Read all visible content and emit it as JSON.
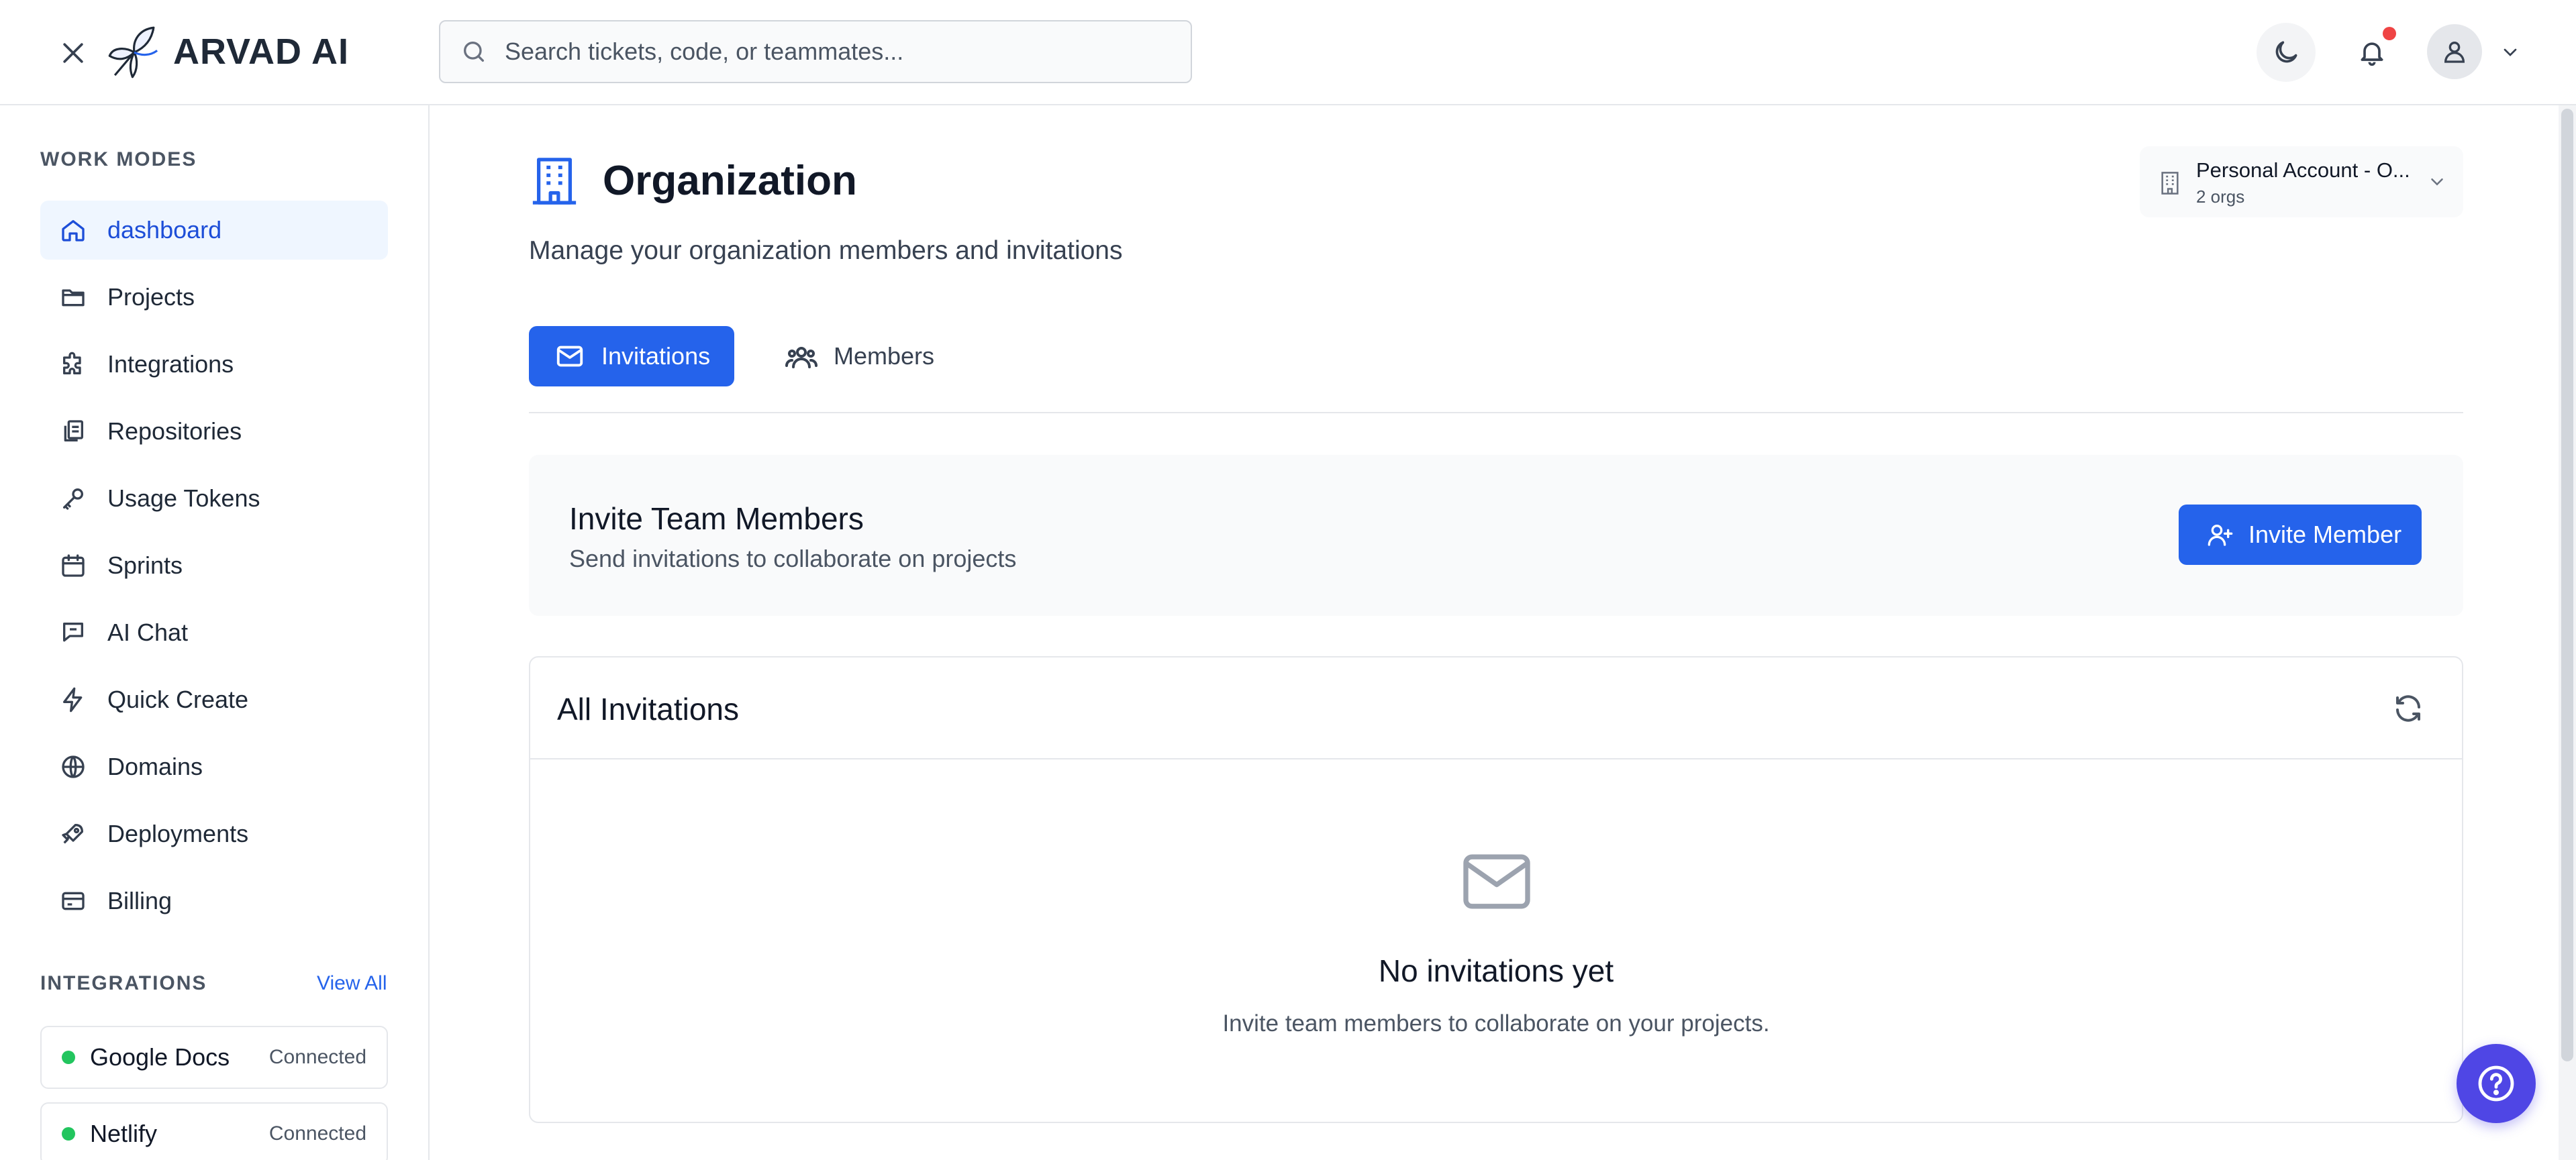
{
  "header": {
    "brand": "ARVAD AI",
    "search_placeholder": "Search tickets, code, or teammates...",
    "icons": [
      "close-icon",
      "butterfly-logo",
      "search-icon",
      "moon-icon",
      "bell-icon",
      "user-icon",
      "chevron-down-icon"
    ],
    "notification_dot_color": "#ef4444"
  },
  "sidebar": {
    "work_modes_label": "WORK MODES",
    "items": [
      {
        "label": "dashboard",
        "icon": "home-icon",
        "active": true
      },
      {
        "label": "Projects",
        "icon": "folder-icon"
      },
      {
        "label": "Integrations",
        "icon": "puzzle-icon"
      },
      {
        "label": "Repositories",
        "icon": "repository-icon"
      },
      {
        "label": "Usage Tokens",
        "icon": "key-icon"
      },
      {
        "label": "Sprints",
        "icon": "calendar-icon"
      },
      {
        "label": "AI Chat",
        "icon": "chat-icon"
      },
      {
        "label": "Quick Create",
        "icon": "lightning-icon"
      },
      {
        "label": "Domains",
        "icon": "globe-icon"
      },
      {
        "label": "Deployments",
        "icon": "rocket-icon"
      },
      {
        "label": "Billing",
        "icon": "credit-card-icon"
      }
    ],
    "integrations_label": "INTEGRATIONS",
    "view_all": "View All",
    "integrations": [
      {
        "name": "Google Docs",
        "status": "Connected"
      },
      {
        "name": "Netlify",
        "status": "Connected"
      }
    ]
  },
  "main": {
    "title": "Organization",
    "subtitle": "Manage your organization members and invitations",
    "org_switcher": {
      "name": "Personal Account - O...",
      "count": "2 orgs"
    },
    "tabs": [
      {
        "label": "Invitations",
        "icon": "mail-icon",
        "active": true
      },
      {
        "label": "Members",
        "icon": "users-icon",
        "active": false
      }
    ],
    "invite_panel": {
      "title": "Invite Team Members",
      "subtitle": "Send invitations to collaborate on projects",
      "button": "Invite Member"
    },
    "invitations": {
      "title": "All Invitations",
      "empty_title": "No invitations yet",
      "empty_subtitle": "Invite team members to collaborate on your projects."
    }
  },
  "colors": {
    "accent": "#2563eb",
    "active_nav_bg": "#eff6ff",
    "connected": "#22c55e",
    "help_fab": "#4f46e5"
  }
}
